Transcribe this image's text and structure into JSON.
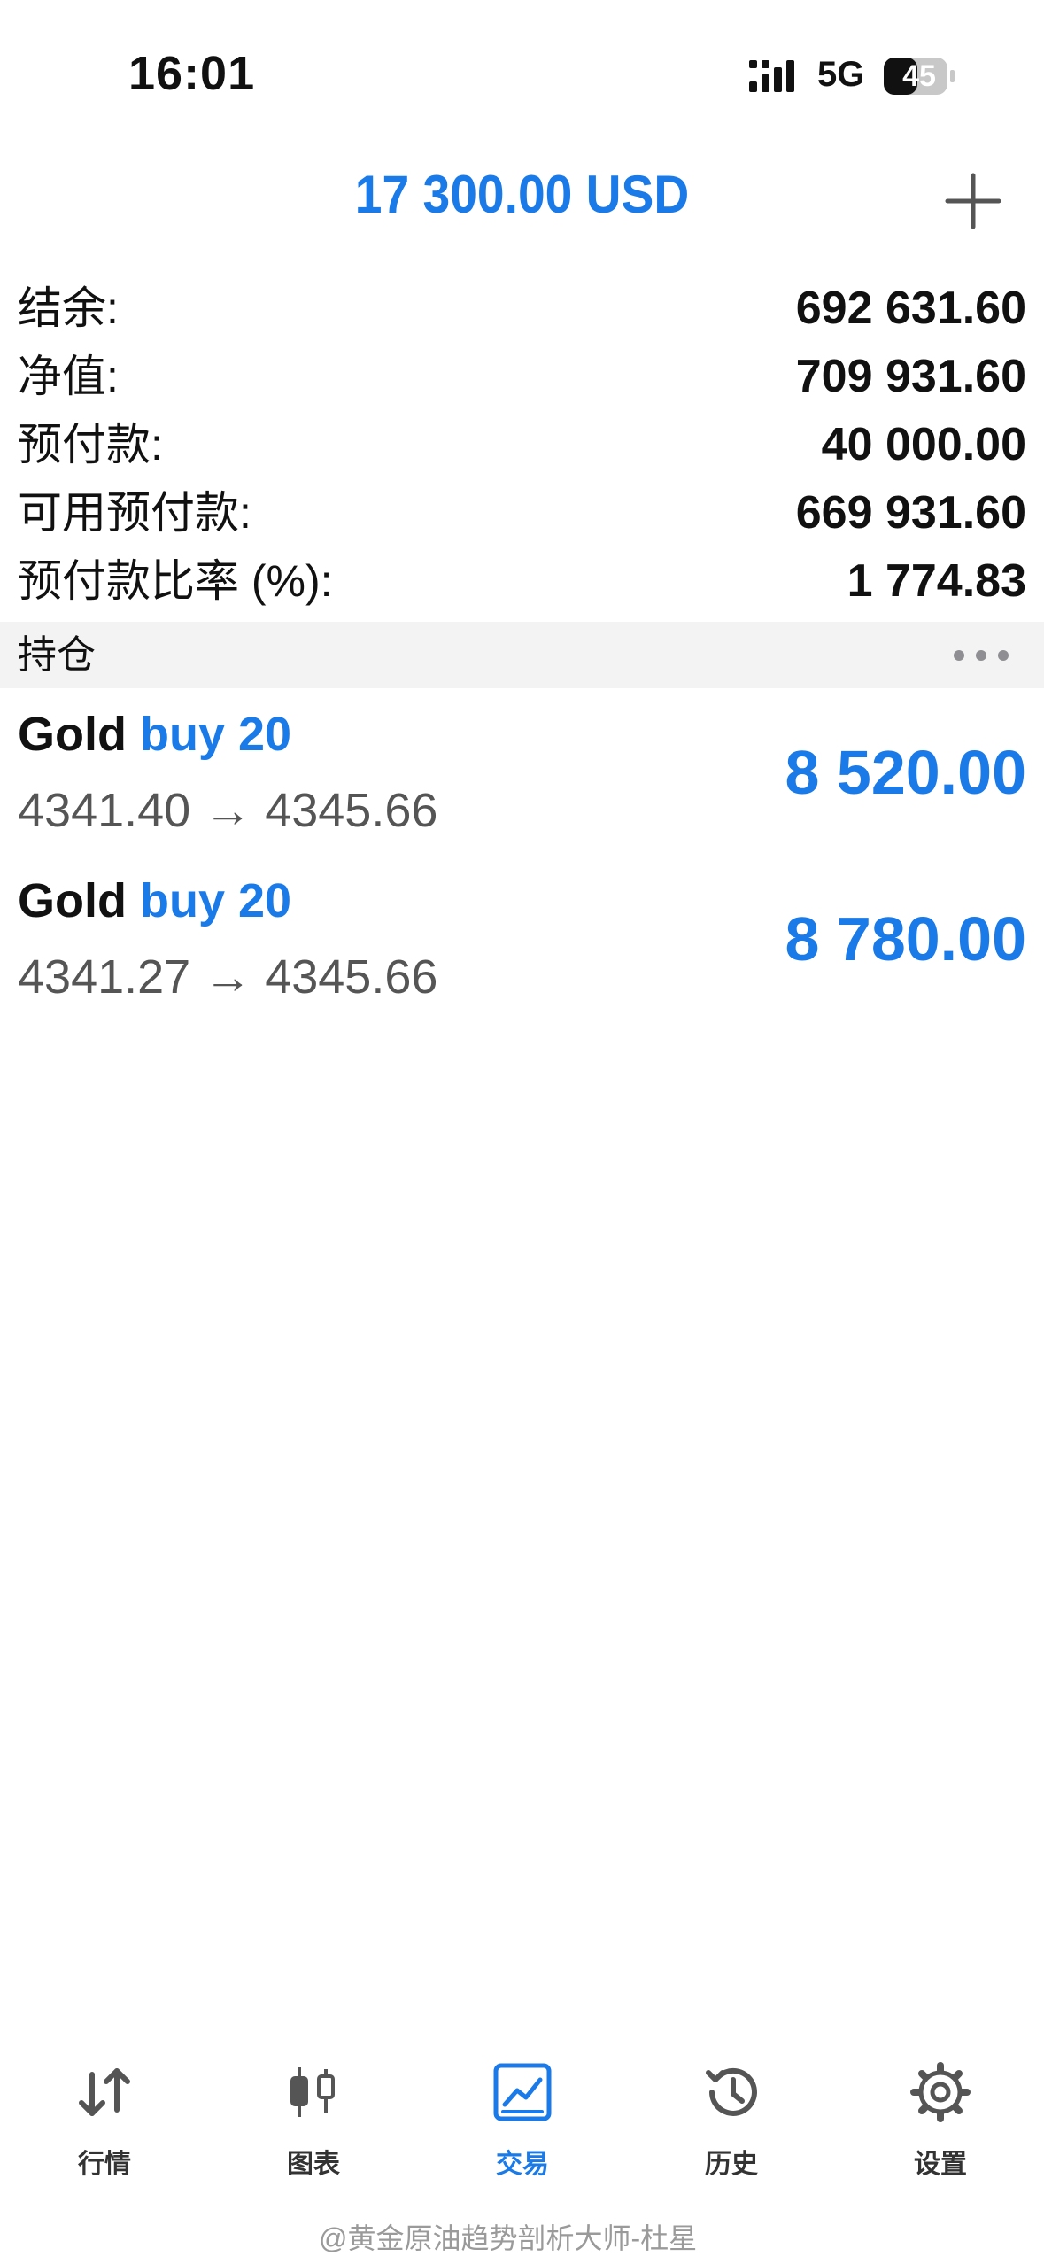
{
  "status_bar": {
    "time": "16:01",
    "network": "5G",
    "battery": "45"
  },
  "header": {
    "title": "17 300.00 USD",
    "add_icon": "plus-icon"
  },
  "summary": [
    {
      "label": "结余:",
      "value": "692 631.60"
    },
    {
      "label": "净值:",
      "value": "709 931.60"
    },
    {
      "label": "预付款:",
      "value": "40 000.00"
    },
    {
      "label": "可用预付款:",
      "value": "669 931.60"
    },
    {
      "label": "预付款比率 (%):",
      "value": "1 774.83"
    }
  ],
  "positions_section": {
    "title": "持仓",
    "more_icon": "more-dots-icon"
  },
  "positions": [
    {
      "symbol": "Gold",
      "direction": "buy 20",
      "prices": "4341.40 → 4345.66",
      "profit": "8 520.00"
    },
    {
      "symbol": "Gold",
      "direction": "buy 20",
      "prices": "4341.27 → 4345.66",
      "profit": "8 780.00"
    }
  ],
  "tabs": [
    {
      "label": "行情",
      "icon": "quotes-arrows-icon",
      "active": false
    },
    {
      "label": "图表",
      "icon": "candlestick-chart-icon",
      "active": false
    },
    {
      "label": "交易",
      "icon": "trade-chart-icon",
      "active": true
    },
    {
      "label": "历史",
      "icon": "history-clock-icon",
      "active": false
    },
    {
      "label": "设置",
      "icon": "settings-gear-icon",
      "active": false
    }
  ],
  "watermark": "@黄金原油趋势剖析大师-杜星",
  "colors": {
    "accent": "#1a7ae8",
    "text": "#111111",
    "secondary": "#555555",
    "section_bg": "#f3f3f4"
  }
}
